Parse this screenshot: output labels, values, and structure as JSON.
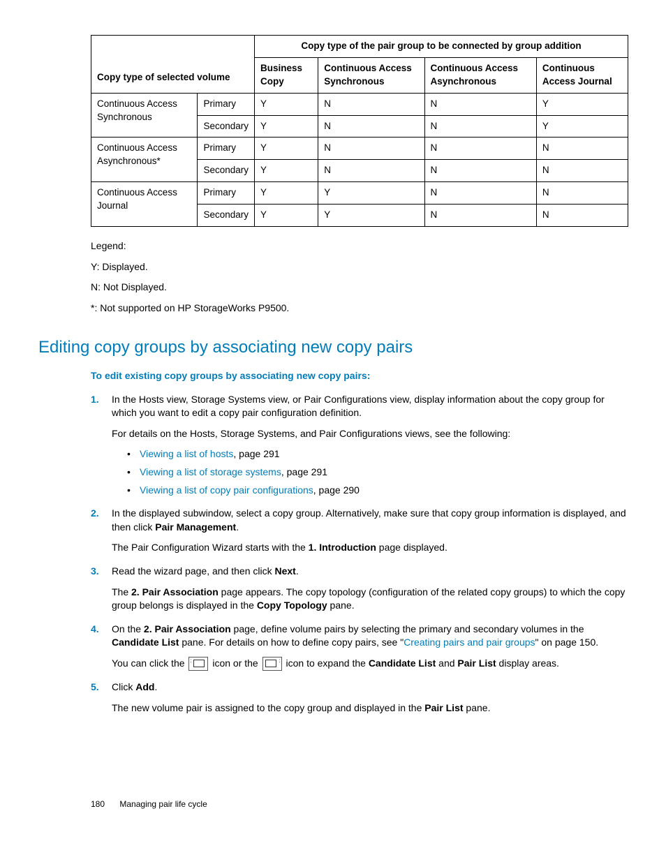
{
  "table": {
    "header_top_right": "Copy type of the pair group to be connected by group addition",
    "header_left": "Copy type of selected volume",
    "cols": {
      "c1": "Business Copy",
      "c2": "Continuous Access Synchronous",
      "c3": "Continuous Access Asynchronous",
      "c4": "Continuous Access Journal"
    },
    "rows": {
      "r1": {
        "label": "Continuous Access Synchronous",
        "sub1": "Primary",
        "v1": [
          "Y",
          "N",
          "N",
          "Y"
        ],
        "sub2": "Secondary",
        "v2": [
          "Y",
          "N",
          "N",
          "Y"
        ]
      },
      "r2": {
        "label": "Continuous Access Asynchronous*",
        "sub1": "Primary",
        "v1": [
          "Y",
          "N",
          "N",
          "N"
        ],
        "sub2": "Secondary",
        "v2": [
          "Y",
          "N",
          "N",
          "N"
        ]
      },
      "r3": {
        "label": "Continuous Access Journal",
        "sub1": "Primary",
        "v1": [
          "Y",
          "Y",
          "N",
          "N"
        ],
        "sub2": "Secondary",
        "v2": [
          "Y",
          "Y",
          "N",
          "N"
        ]
      }
    }
  },
  "legend": {
    "title": "Legend:",
    "l1": "Y: Displayed.",
    "l2": "N: Not Displayed.",
    "l3": "*: Not supported on HP StorageWorks P9500."
  },
  "heading": "Editing copy groups by associating new copy pairs",
  "subheading": "To edit existing copy groups by associating new copy pairs:",
  "steps": {
    "s1": {
      "num": "1.",
      "p1": "In the Hosts view, Storage Systems view, or Pair Configurations view, display information about the copy group for which you want to edit a copy pair configuration definition.",
      "p2": "For details on the Hosts, Storage Systems, and Pair Configurations views, see the following:",
      "links": {
        "a1": "Viewing a list of hosts",
        "a1_suffix": ", page 291",
        "a2": "Viewing a list of storage systems",
        "a2_suffix": ", page 291",
        "a3": "Viewing a list of copy pair configurations",
        "a3_suffix": ", page 290"
      }
    },
    "s2": {
      "num": "2.",
      "p1a": "In the displayed subwindow, select a copy group. Alternatively, make sure that copy group information is displayed, and then click ",
      "p1b": "Pair Management",
      "p1c": ".",
      "p2a": "The Pair Configuration Wizard starts with the ",
      "p2b": "1. Introduction",
      "p2c": " page displayed."
    },
    "s3": {
      "num": "3.",
      "p1a": "Read the wizard page, and then click ",
      "p1b": "Next",
      "p1c": ".",
      "p2a": "The ",
      "p2b": "2. Pair Association",
      "p2c": " page appears. The copy topology (configuration of the related copy groups) to which the copy group belongs is displayed in the ",
      "p2d": "Copy Topology",
      "p2e": " pane."
    },
    "s4": {
      "num": "4.",
      "p1a": "On the ",
      "p1b": "2. Pair Association",
      "p1c": " page, define volume pairs by selecting the primary and secondary volumes in the ",
      "p1d": "Candidate List",
      "p1e": " pane. For details on how to define copy pairs, see \"",
      "p1link": "Creating pairs and pair groups",
      "p1f": "\" on page 150.",
      "p2a": "You can click the ",
      "p2b": " icon or the ",
      "p2c": " icon to expand the ",
      "p2d": "Candidate List",
      "p2e": " and ",
      "p2f": "Pair List",
      "p2g": " display areas."
    },
    "s5": {
      "num": "5.",
      "p1a": "Click ",
      "p1b": "Add",
      "p1c": ".",
      "p2a": "The new volume pair is assigned to the copy group and displayed in the ",
      "p2b": "Pair List",
      "p2c": " pane."
    }
  },
  "footer": {
    "page": "180",
    "title": "Managing pair life cycle"
  }
}
